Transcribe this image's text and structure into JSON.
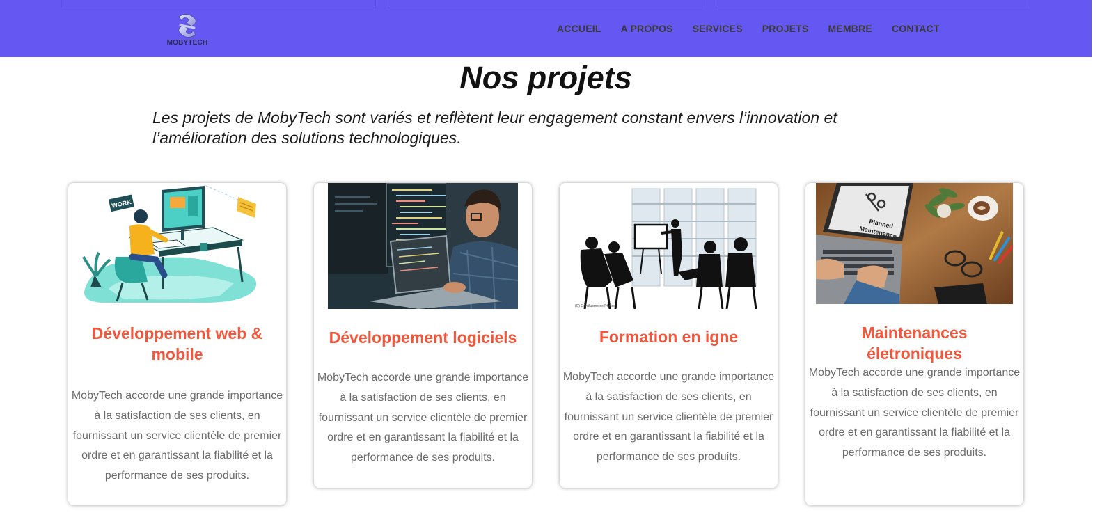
{
  "brand": {
    "name": "MOBYTECH"
  },
  "nav": {
    "items": [
      "ACCUEIL",
      "A PROPOS",
      "SERVICES",
      "PROJETS",
      "MEMBRE",
      "CONTACT"
    ]
  },
  "page": {
    "title": "Nos projets",
    "intro": "Les projets de MobyTech sont variés et reflètent leur engagement constant envers l’innovation et l’amélioration des solutions technologiques."
  },
  "cards": [
    {
      "title": "Développement web & mobile",
      "text": "MobyTech accorde une grande importance à la satisfaction de ses clients, en fournissant un service clientèle de premier ordre et en garantissant la fiabilité et la performance de ses produits.",
      "image_word": "WORK"
    },
    {
      "title": "Développement logiciels",
      "text": "MobyTech accorde une grande importance à la satisfaction de ses clients, en fournissant un service clientèle de premier ordre et en garantissant la fiabilité et la performance de ses produits."
    },
    {
      "title": "Formation en igne",
      "text": "MobyTech accorde une grande importance à la satisfaction de ses clients, en fournissant un service clientèle de premier ordre et en garantissant la fiabilité et la performance de ses produits.",
      "image_caption": "(C) Gentiluomo de Photos"
    },
    {
      "title": "Maintenances életroniques",
      "text": "MobyTech accorde une grande importance à la satisfaction de ses clients, en fournissant un service clientèle de premier ordre et en garantissant la fiabilité et la performance de ses produits.",
      "image_words": [
        "Planned",
        "Maintenance"
      ]
    }
  ],
  "colors": {
    "navbar": "#6557f2",
    "accent": "#f0573d",
    "body_text": "#6b6b6b"
  }
}
